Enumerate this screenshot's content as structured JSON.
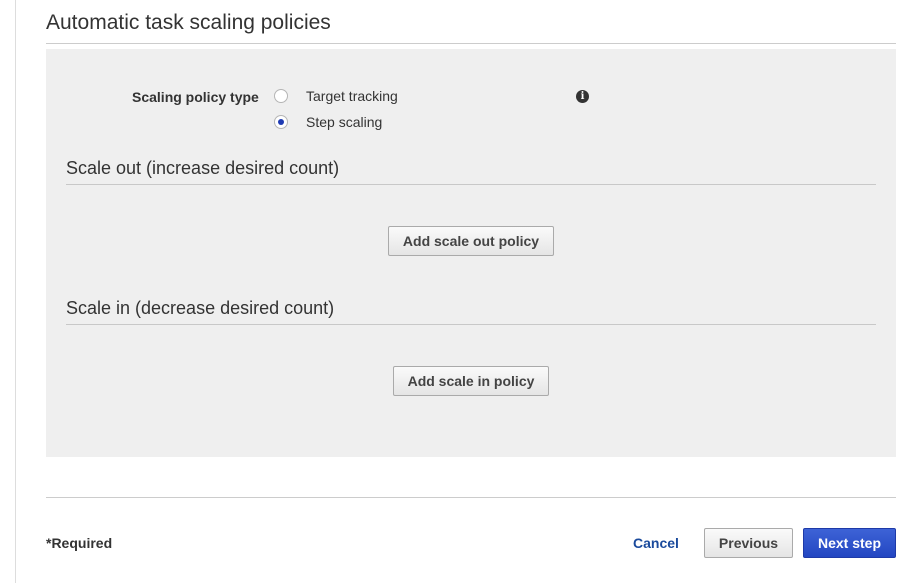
{
  "section": {
    "title": "Automatic task scaling policies"
  },
  "policy_type": {
    "label": "Scaling policy type",
    "options": [
      {
        "label": "Target tracking",
        "selected": false
      },
      {
        "label": "Step scaling",
        "selected": true
      }
    ],
    "info_icon": "info-icon"
  },
  "scale_out": {
    "title": "Scale out (increase desired count)",
    "button_label": "Add scale out policy"
  },
  "scale_in": {
    "title": "Scale in (decrease desired count)",
    "button_label": "Add scale in policy"
  },
  "footer": {
    "required_label": "*Required",
    "cancel_label": "Cancel",
    "previous_label": "Previous",
    "next_label": "Next step"
  },
  "colors": {
    "accent": "#2346c2",
    "link": "#1a4a9c",
    "panel_bg": "#efefef"
  }
}
